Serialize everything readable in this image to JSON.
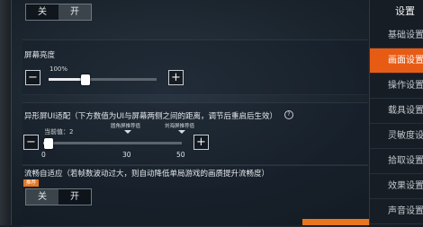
{
  "toggle_top": {
    "off_label": "关",
    "on_label": "开",
    "selected": "on"
  },
  "brightness": {
    "title": "屏幕亮度",
    "value_label": "100%",
    "level_fraction": 0.34,
    "minus": "−",
    "plus": "+"
  },
  "notch": {
    "title": "异形屏UI适配（下方数值为UI与屏幕两侧之间的距离，调节后重启后生效）",
    "help_icon": "?",
    "current_label": "当前值：2",
    "marker_recommended": "圆角屏推荐值",
    "marker_notch": "刘海屏推荐值",
    "tick_0": "0",
    "tick_30": "30",
    "tick_50": "50",
    "value": 2,
    "min": 0,
    "max": 50,
    "minus": "−",
    "plus": "+"
  },
  "smooth": {
    "title": "流畅自适应（若帧数波动过大，则自动降低单局游戏的画质提升流畅度）",
    "tag": "推荐",
    "off_label": "关",
    "on_label": "开",
    "selected": "off"
  },
  "sidebar": {
    "title": "设置",
    "items": [
      {
        "label": "基础设置"
      },
      {
        "label": "画面设置"
      },
      {
        "label": "操作设置"
      },
      {
        "label": "载具设置"
      },
      {
        "label": "灵敏度设置"
      },
      {
        "label": "拾取设置"
      },
      {
        "label": "效果设置"
      },
      {
        "label": "声音设置"
      }
    ],
    "active_index": 1
  },
  "colors": {
    "accent": "#e85b14",
    "tag": "#e8761e"
  }
}
